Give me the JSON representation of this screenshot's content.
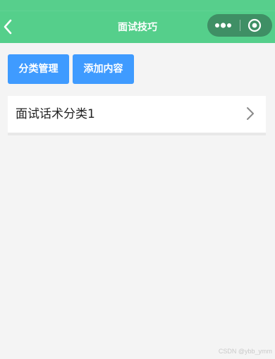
{
  "nav": {
    "title": "面试技巧",
    "back_icon": "chevron-left-icon",
    "more_icon": "more-dots-icon",
    "close_icon": "target-circle-icon"
  },
  "toolbar": {
    "category_manage_label": "分类管理",
    "add_content_label": "添加内容"
  },
  "list": {
    "items": [
      {
        "label": "面试话术分类1",
        "icon": "chevron-right-icon"
      }
    ]
  },
  "watermark": "CSDN @ybb_ymm",
  "colors": {
    "nav_background": "#55cf8b",
    "capsule_background": "#3f8f65",
    "button_blue": "#3f9bff",
    "page_background": "#f4f4f4"
  }
}
